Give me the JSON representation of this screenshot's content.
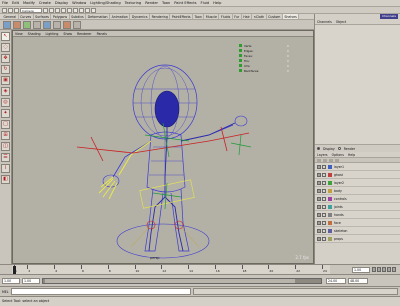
{
  "menubar": {
    "items": [
      "File",
      "Edit",
      "Modify",
      "Create",
      "Display",
      "Window",
      "Lighting/Shading",
      "Texturing",
      "Render",
      "Toon",
      "Paint Effects",
      "Fluid",
      "Help"
    ]
  },
  "status": {
    "field": "Camera"
  },
  "shelf_tabs": [
    {
      "label": "General",
      "active": false
    },
    {
      "label": "Curves",
      "active": false
    },
    {
      "label": "Surfaces",
      "active": false
    },
    {
      "label": "Polygons",
      "active": false
    },
    {
      "label": "Subdivs",
      "active": false
    },
    {
      "label": "Deformation",
      "active": false
    },
    {
      "label": "Animation",
      "active": false
    },
    {
      "label": "Dynamics",
      "active": false
    },
    {
      "label": "Rendering",
      "active": false
    },
    {
      "label": "PaintEffects",
      "active": false
    },
    {
      "label": "Toon",
      "active": false
    },
    {
      "label": "Muscle",
      "active": false
    },
    {
      "label": "Fluids",
      "active": false
    },
    {
      "label": "Fur",
      "active": false
    },
    {
      "label": "Hair",
      "active": false
    },
    {
      "label": "nCloth",
      "active": false
    },
    {
      "label": "Custom",
      "active": false
    },
    {
      "label": "Shelves",
      "active": true
    }
  ],
  "viewport": {
    "menu": [
      "View",
      "Shading",
      "Lighting",
      "Show",
      "Renderer",
      "Panels"
    ],
    "camera_label": "persp",
    "fps": "2.7 fps",
    "hud": [
      {
        "label": "Verts:",
        "value": "0"
      },
      {
        "label": "Edges:",
        "value": "0"
      },
      {
        "label": "Faces:",
        "value": "0"
      },
      {
        "label": "Tris:",
        "value": "0"
      },
      {
        "label": "UVs:",
        "value": "0"
      },
      {
        "label": "Backfaces:",
        "value": "0"
      }
    ],
    "colors": {
      "background": "#b3b0a6",
      "wire": "#3a3ad0",
      "joint": "#2a2aa8",
      "ik": "#e8e84a",
      "ctrl_red": "#c82020",
      "ctrl_green": "#209a3a"
    }
  },
  "channel_box": {
    "top_button": "Channels",
    "header": [
      "Channels",
      "Object"
    ]
  },
  "layers": {
    "mode": [
      "Display",
      "Render"
    ],
    "menu": [
      "Layers",
      "Options",
      "Help"
    ],
    "items": [
      {
        "visible": "V",
        "name": "layer1",
        "color": "#4060c0"
      },
      {
        "visible": "V",
        "name": "ghost",
        "color": "#c04040"
      },
      {
        "visible": "V",
        "name": "layer2",
        "color": "#40a040"
      },
      {
        "visible": "V",
        "name": "body",
        "color": "#c0a040"
      },
      {
        "visible": "V",
        "name": "controls",
        "color": "#a040a0"
      },
      {
        "visible": "V",
        "name": "joints",
        "color": "#40a0a0"
      },
      {
        "visible": "V",
        "name": "hands",
        "color": "#808080"
      },
      {
        "visible": "V",
        "name": "face",
        "color": "#c07040"
      },
      {
        "visible": "V",
        "name": "skeleton",
        "color": "#6060a0"
      },
      {
        "visible": "V",
        "name": "props",
        "color": "#a0a060"
      }
    ]
  },
  "timeline": {
    "ticks": [
      "1",
      "2",
      "4",
      "6",
      "8",
      "10",
      "12",
      "14",
      "16",
      "18",
      "20",
      "22",
      "24"
    ],
    "current_frame": "1.00",
    "current_frame_value": 1
  },
  "range": {
    "start": "1.00",
    "start2": "1.00",
    "end": "24.00",
    "end2": "48.00"
  },
  "commandline": {
    "label": "MEL"
  },
  "helpline": {
    "text": "Select Tool: select an object"
  }
}
